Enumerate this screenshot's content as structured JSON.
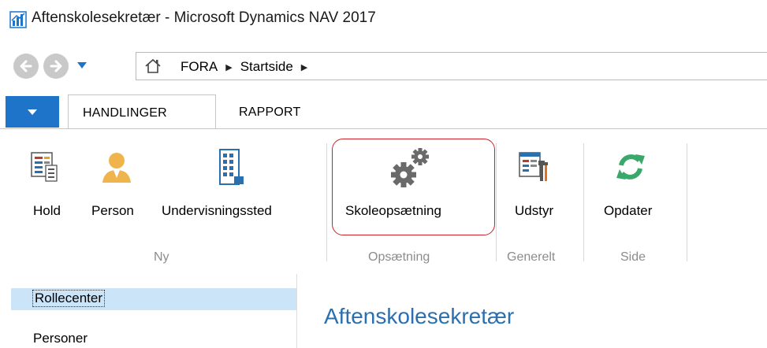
{
  "window": {
    "title": "Aftenskolesekretær - Microsoft Dynamics NAV 2017",
    "app_icon": "dynamics-nav-icon"
  },
  "address_bar": {
    "breadcrumb": [
      "FORA",
      "Startside"
    ]
  },
  "ribbon": {
    "tabs": [
      {
        "label": "HANDLINGER",
        "active": true
      },
      {
        "label": "RAPPORT",
        "active": false
      }
    ],
    "groups": [
      {
        "label": "Ny",
        "buttons": [
          {
            "label": "Hold",
            "icon": "team-list-icon"
          },
          {
            "label": "Person",
            "icon": "person-icon"
          },
          {
            "label": "Undervisningssted",
            "icon": "building-icon"
          }
        ]
      },
      {
        "label": "Opsætning",
        "buttons": [
          {
            "label": "Skoleopsætning",
            "icon": "gears-icon"
          }
        ]
      },
      {
        "label": "Generelt",
        "buttons": [
          {
            "label": "Udstyr",
            "icon": "equipment-icon"
          }
        ]
      },
      {
        "label": "Side",
        "buttons": [
          {
            "label": "Opdater",
            "icon": "refresh-icon"
          }
        ]
      }
    ]
  },
  "nav_pane": {
    "items": [
      {
        "label": "Rollecenter",
        "selected": true
      },
      {
        "label": "Personer",
        "selected": false
      }
    ]
  },
  "content": {
    "title": "Aftenskolesekretær"
  },
  "colors": {
    "accent": "#1e74c9",
    "highlight": "#d0202c",
    "selected_nav": "#cbe4f7",
    "content_title": "#2a6fb0",
    "refresh_green": "#3aa86b"
  }
}
